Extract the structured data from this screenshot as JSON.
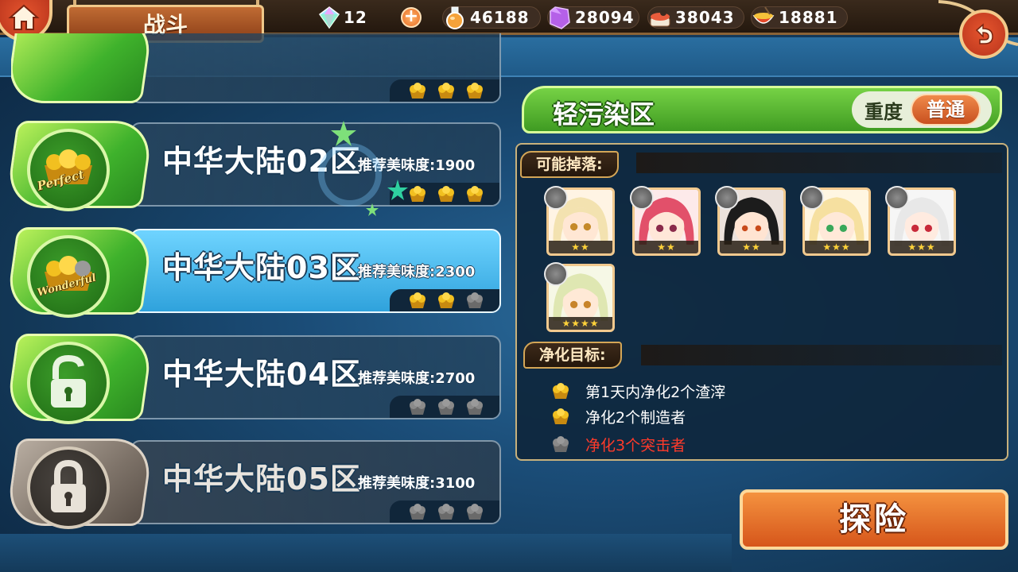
{
  "header": {
    "title": "战斗",
    "resources": [
      {
        "icon": "rainbow-gem-icon",
        "value": "12"
      },
      {
        "icon": "potion-flask-icon",
        "value": "46188"
      },
      {
        "icon": "purple-crystal-icon",
        "value": "28094"
      },
      {
        "icon": "sushi-ingredient-icon",
        "value": "38043"
      },
      {
        "icon": "food-bowl-icon",
        "value": "18881"
      }
    ]
  },
  "stages": [
    {
      "name": "中华大陆02区",
      "recommend": "推荐美味度:1900",
      "medal": "Perfect",
      "cakes": [
        1,
        1,
        1
      ],
      "state": "cleared"
    },
    {
      "name": "中华大陆03区",
      "recommend": "推荐美味度:2300",
      "medal": "Wonderful",
      "cakes": [
        1,
        1,
        0
      ],
      "state": "selected"
    },
    {
      "name": "中华大陆04区",
      "recommend": "推荐美味度:2700",
      "medal": "",
      "cakes": [
        0,
        0,
        0
      ],
      "state": "unlocked"
    },
    {
      "name": "中华大陆05区",
      "recommend": "推荐美味度:3100",
      "medal": "",
      "cakes": [
        0,
        0,
        0
      ],
      "state": "locked"
    }
  ],
  "zone": {
    "title": "轻污染区",
    "difficulty_label": "重度",
    "difficulty_value": "普通"
  },
  "drops": {
    "label": "可能掉落:",
    "items": [
      {
        "stars": "★★",
        "hair": "#f3e2b0",
        "tag": "whisk-icon"
      },
      {
        "stars": "★★",
        "hair": "#e2506a",
        "tag": "cloche-icon"
      },
      {
        "stars": "★★",
        "hair": "#1c1c1c",
        "tag": "steam-icon"
      },
      {
        "stars": "★★★",
        "hair": "#f6e0a0",
        "tag": "plate-icon"
      },
      {
        "stars": "★★★",
        "hair": "#e8e8e8",
        "tag": "steam-icon"
      },
      {
        "stars": "★★★★",
        "hair": "#dfe7b2",
        "tag": "whisk-icon"
      }
    ]
  },
  "goals": {
    "label": "净化目标:",
    "items": [
      {
        "text": "第1天内净化2个渣滓",
        "done": true
      },
      {
        "text": "净化2个制造者",
        "done": true
      },
      {
        "text": "净化3个突击者",
        "done": false
      }
    ]
  },
  "explore_label": "探险",
  "colors": {
    "cake_gold": "#f2c020",
    "cake_gray": "#8a8a8a",
    "fail_red": "#ff3a2a",
    "accent_orange": "#e06a28",
    "zone_green": "#5cbf35"
  }
}
